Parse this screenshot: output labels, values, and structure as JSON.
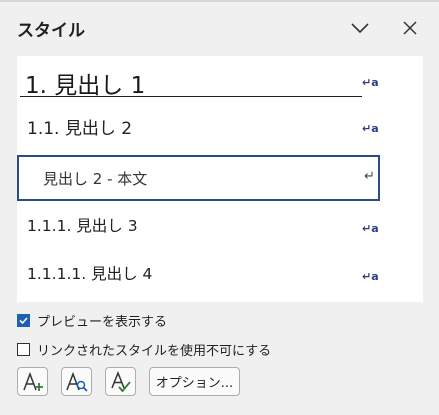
{
  "pane": {
    "title": "スタイル"
  },
  "styles": [
    {
      "label": "1.  見出し 1",
      "marker": "↵a"
    },
    {
      "label": "1.1.   見出し 2",
      "marker": "↵a"
    },
    {
      "label": "見出し 2 - 本文",
      "marker": "↵"
    },
    {
      "label": "1.1.1.   見出し 3",
      "marker": "↵a"
    },
    {
      "label": "1.1.1.1.   見出し 4",
      "marker": "↵a"
    }
  ],
  "options": {
    "preview_label": "プレビューを表示する",
    "preview_checked": true,
    "disable_linked_label": "リンクされたスタイルを使用不可にする",
    "disable_linked_checked": false
  },
  "toolbar": {
    "new_style_icon": "new-style",
    "style_inspector_icon": "style-inspector",
    "manage_styles_icon": "manage-styles",
    "options_label": "オプション..."
  },
  "colors": {
    "selected_border": "#2a4d86",
    "checkbox_on": "#1e5fb4",
    "marker": "#2a3c8a"
  }
}
